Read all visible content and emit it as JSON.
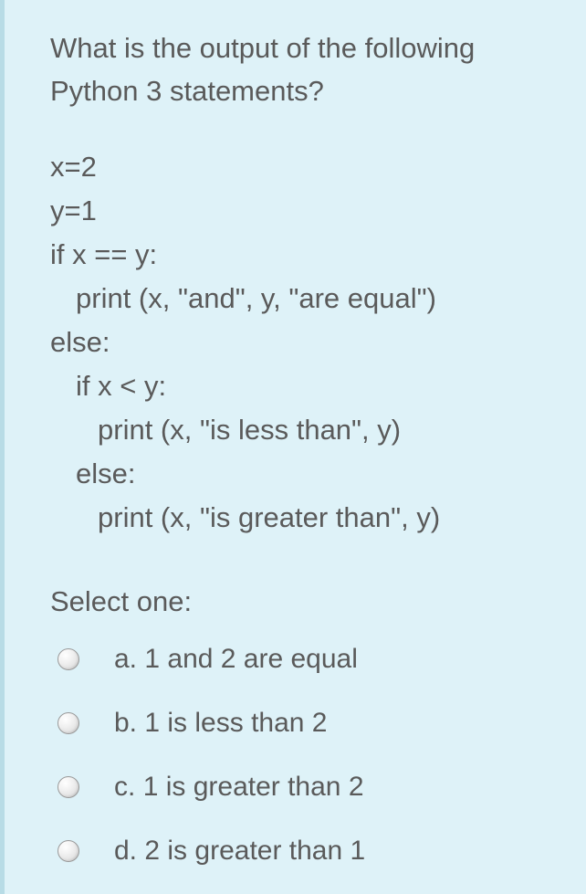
{
  "question": {
    "text": "What is the output of the following Python 3 statements?",
    "code": {
      "line1": "x=2",
      "line2": "y=1",
      "line3": "if x == y:",
      "line4": "print (x, \"and\", y, \"are equal\")",
      "line5": "else:",
      "line6": "if x < y:",
      "line7": "print (x, \"is less than\", y)",
      "line8": "else:",
      "line9": "print (x, \"is greater than\", y)"
    },
    "select_label": "Select one:",
    "options": [
      {
        "letter": "a.",
        "text": "1 and 2 are equal"
      },
      {
        "letter": "b.",
        "text": "1 is less than 2"
      },
      {
        "letter": "c.",
        "text": "1 is greater than 2"
      },
      {
        "letter": "d.",
        "text": "2 is greater than 1"
      }
    ]
  }
}
